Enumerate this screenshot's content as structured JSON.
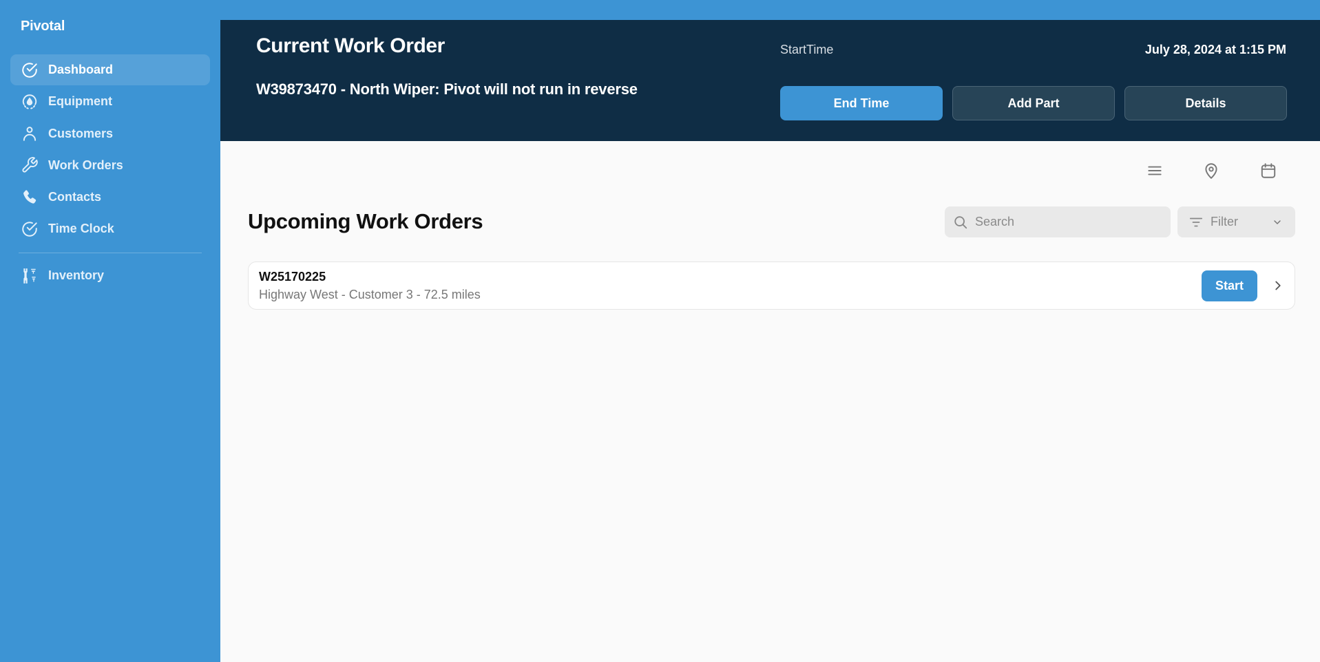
{
  "app": {
    "name": "Pivotal"
  },
  "sidebar": {
    "items": [
      {
        "label": "Dashboard",
        "icon": "check-circle-icon",
        "active": true
      },
      {
        "label": "Equipment",
        "icon": "water-drop-icon",
        "active": false
      },
      {
        "label": "Customers",
        "icon": "user-icon",
        "active": false
      },
      {
        "label": "Work Orders",
        "icon": "wrench-icon",
        "active": false
      },
      {
        "label": "Contacts",
        "icon": "phone-icon",
        "active": false
      },
      {
        "label": "Time Clock",
        "icon": "check-circle-icon",
        "active": false
      }
    ],
    "bottom_items": [
      {
        "label": "Inventory",
        "icon": "tools-icon",
        "active": false
      }
    ]
  },
  "current_work_order": {
    "title": "Current Work Order",
    "description": "W39873470 - North Wiper: Pivot will not run in reverse",
    "start_time_label": "StartTime",
    "start_time_value": "July 28, 2024 at 1:15 PM",
    "buttons": {
      "end_time": "End Time",
      "add_part": "Add Part",
      "details": "Details"
    }
  },
  "view_toggle": {
    "icons": [
      "list-icon",
      "map-pin-icon",
      "calendar-icon"
    ]
  },
  "upcoming": {
    "title": "Upcoming Work Orders",
    "search": {
      "placeholder": "Search",
      "value": ""
    },
    "filter": {
      "label": "Filter"
    },
    "items": [
      {
        "id": "W25170225",
        "meta": "Highway West - Customer 3 - 72.5 miles",
        "action": "Start"
      }
    ]
  },
  "colors": {
    "primary": "#3d94d4",
    "header_dark": "#0f2d45",
    "secondary_button": "#274457",
    "background": "#fafafa"
  }
}
